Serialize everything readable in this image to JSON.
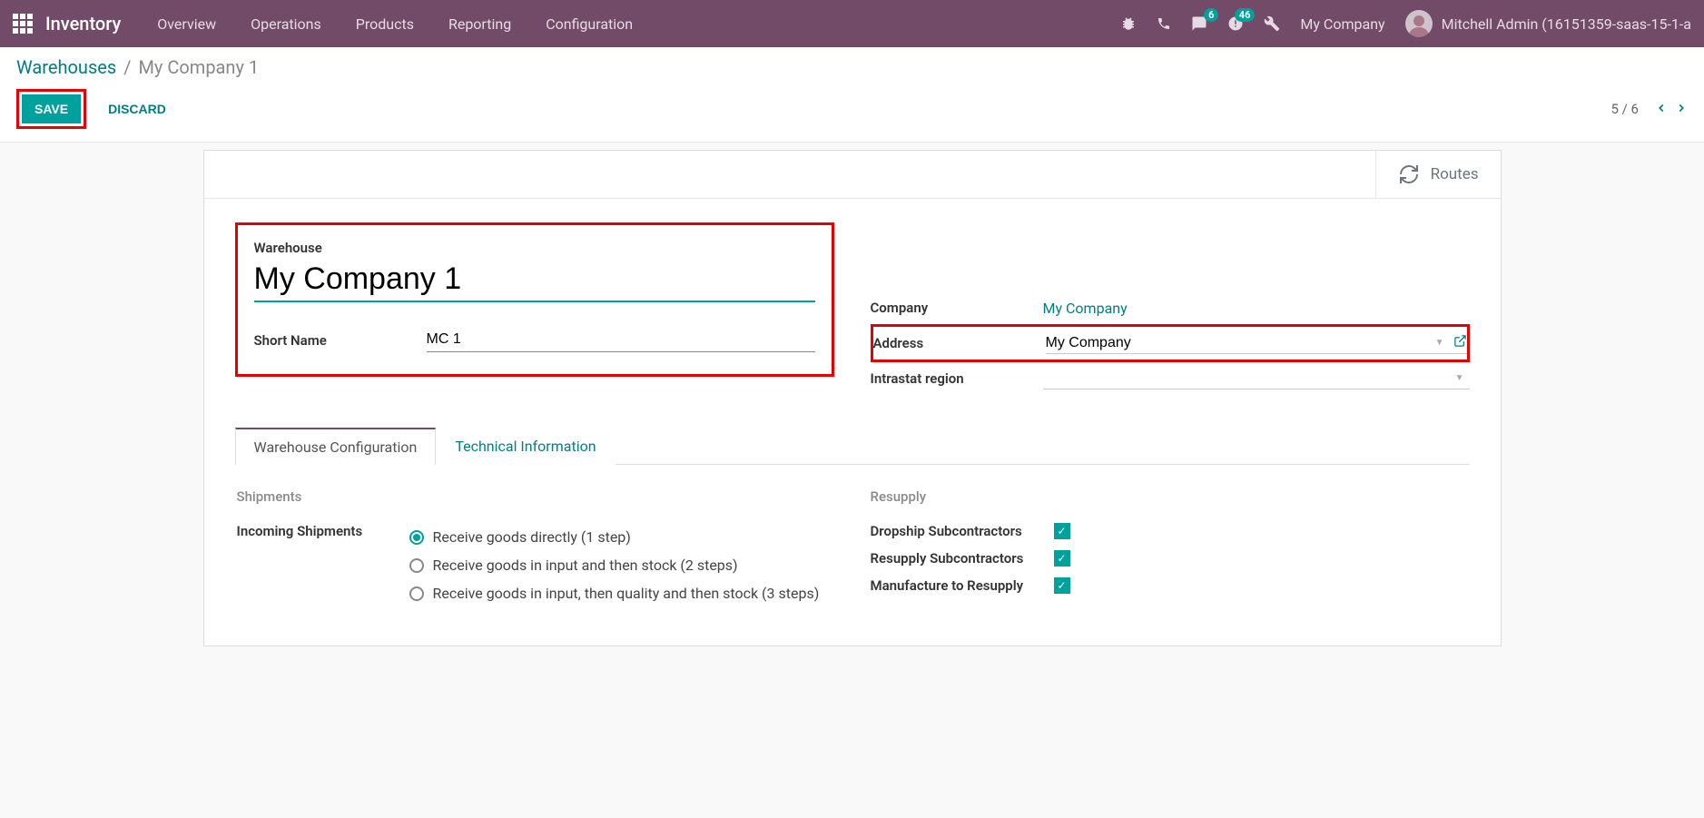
{
  "topbar": {
    "app_title": "Inventory",
    "nav": [
      "Overview",
      "Operations",
      "Products",
      "Reporting",
      "Configuration"
    ],
    "badges": {
      "msgs": "6",
      "activities": "46"
    },
    "company": "My Company",
    "user": "Mitchell Admin (16151359-saas-15-1-a"
  },
  "breadcrumb": {
    "root": "Warehouses",
    "current": "My Company 1"
  },
  "actions": {
    "save": "SAVE",
    "discard": "DISCARD"
  },
  "pager": {
    "pos": "5 / 6"
  },
  "statbox": {
    "routes": "Routes"
  },
  "form": {
    "warehouse_label": "Warehouse",
    "warehouse_value": "My Company 1",
    "short_name_label": "Short Name",
    "short_name_value": "MC 1",
    "company_label": "Company",
    "company_value": "My Company",
    "address_label": "Address",
    "address_value": "My Company",
    "intrastat_label": "Intrastat region",
    "intrastat_value": ""
  },
  "tabs": {
    "config": "Warehouse Configuration",
    "tech": "Technical Information"
  },
  "shipments": {
    "section": "Shipments",
    "incoming_label": "Incoming Shipments",
    "incoming_opts": [
      "Receive goods directly (1 step)",
      "Receive goods in input and then stock (2 steps)",
      "Receive goods in input, then quality and then stock (3 steps)"
    ]
  },
  "resupply": {
    "section": "Resupply",
    "rows": [
      "Dropship Subcontractors",
      "Resupply Subcontractors",
      "Manufacture to Resupply"
    ]
  }
}
